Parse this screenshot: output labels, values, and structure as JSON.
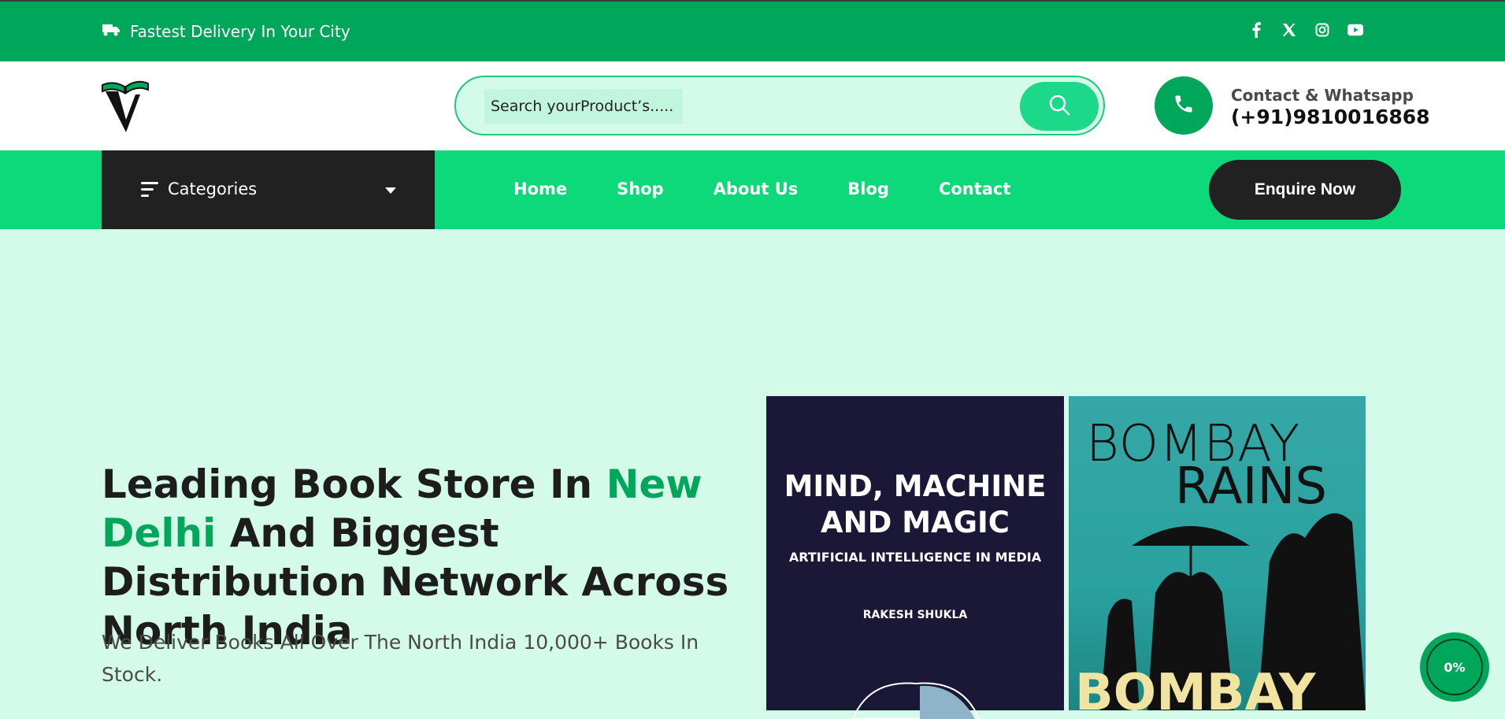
{
  "topbar": {
    "delivery_text": "Fastest Delivery In Your City",
    "delivery_icon": "truck-icon",
    "socials": [
      "facebook-icon",
      "x-icon",
      "instagram-icon",
      "youtube-icon"
    ]
  },
  "header": {
    "logo_icon": "book-v-logo",
    "search_placeholder": "Search yourProduct’s.....",
    "search_icon": "search-icon",
    "contact_label": "Contact & Whatsapp",
    "contact_number": "(+91)9810016868"
  },
  "nav": {
    "categories_label": "Categories",
    "links": [
      "Home",
      "Shop",
      "About Us",
      "Blog",
      "Contact"
    ],
    "cta": "Enquire Now"
  },
  "hero": {
    "title_part1": "Leading Book Store In ",
    "title_accent": "New Delhi",
    "title_part2": " And Biggest Distribution Network Across North India",
    "subtitle": "We Deliver Books All Over The North India 10,000+ Books In Stock."
  },
  "books": {
    "book1": {
      "title": "MIND, MACHINE AND MAGIC",
      "subtitle": "ARTIFICIAL INTELLIGENCE IN MEDIA",
      "author": "RAKESH SHUKLA"
    },
    "book2": {
      "title_line1": "BOMBAY",
      "title_line2": "RAINS",
      "title_line3": "BOMBAY"
    }
  },
  "progress": {
    "value": "0%"
  },
  "colors": {
    "brand_green": "#00a65a",
    "nav_green": "#0dd97a",
    "bg_mint": "#d4fbe9",
    "dark": "#212121"
  }
}
